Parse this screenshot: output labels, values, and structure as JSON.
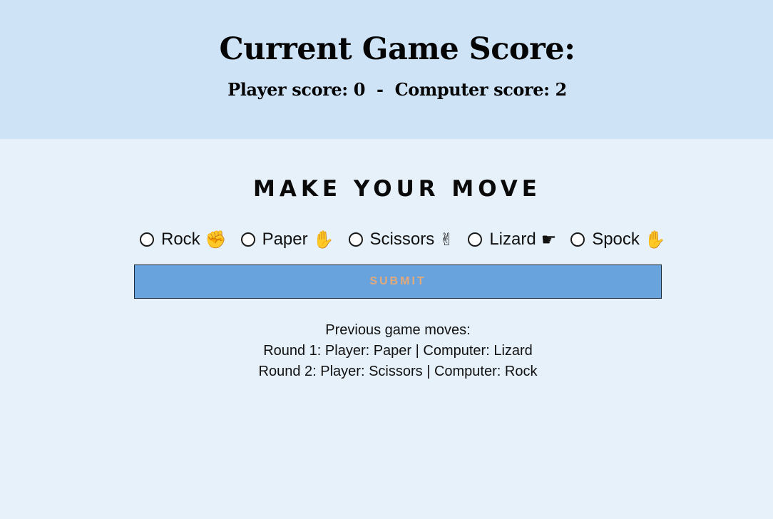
{
  "header": {
    "title": "Current Game Score:",
    "player_score": "Player score: 0",
    "separator": "-",
    "computer_score": "Computer score: 2"
  },
  "move": {
    "heading": "MAKE YOUR MOVE",
    "options": [
      {
        "label": "Rock",
        "icon": "rock-hand-icon",
        "selected": false
      },
      {
        "label": "Paper",
        "icon": "paper-hand-icon",
        "selected": false
      },
      {
        "label": "Scissors",
        "icon": "scissors-hand-icon",
        "selected": false
      },
      {
        "label": "Lizard",
        "icon": "lizard-hand-icon",
        "selected": false
      },
      {
        "label": "Spock",
        "icon": "spock-hand-icon",
        "selected": false
      }
    ],
    "submit_label": "SUBMIT"
  },
  "history": {
    "title": "Previous game moves:",
    "rounds": [
      "Round 1: Player: Paper | Computer: Lizard",
      "Round 2: Player: Scissors | Computer: Rock"
    ]
  },
  "colors": {
    "header_bg": "#cfe3f7",
    "page_bg": "#e7f1fa",
    "button_bg": "#69a3dd",
    "button_text": "#e2a979"
  }
}
